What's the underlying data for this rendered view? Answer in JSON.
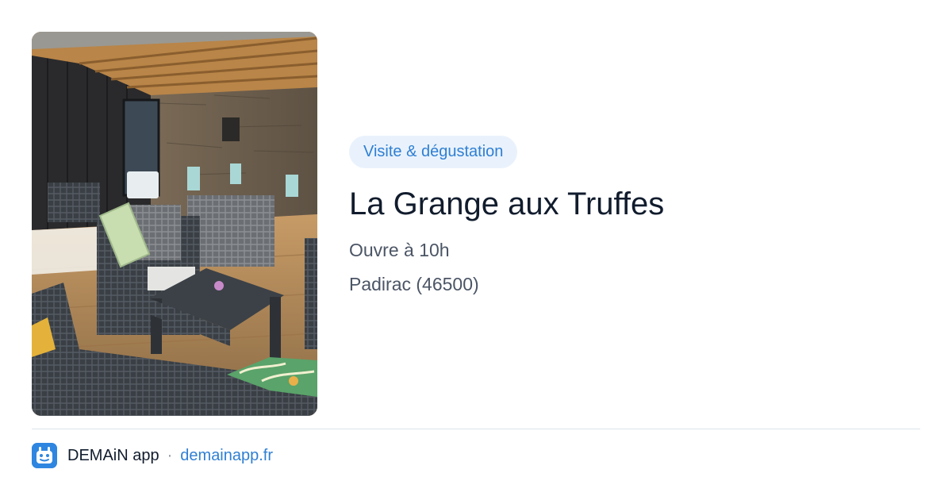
{
  "card": {
    "category_tag": "Visite & dégustation",
    "title": "La Grange aux Truffes",
    "opening_hours": "Ouvre à 10h",
    "location": "Padirac (46500)",
    "photo_alt": "Terrasse avec salon de jardin en résine tressée",
    "photo_icon": "terrace-photo"
  },
  "footer": {
    "app_name": "DEMAiN app",
    "separator": "·",
    "site_link": "demainapp.fr",
    "app_icon": "demain-app-icon"
  },
  "colors": {
    "tag_background": "#e9f2fc",
    "accent": "#2f7fd3",
    "title": "#111c2d",
    "secondary_text": "#4b5565",
    "app_icon_background": "#2f86e0"
  }
}
